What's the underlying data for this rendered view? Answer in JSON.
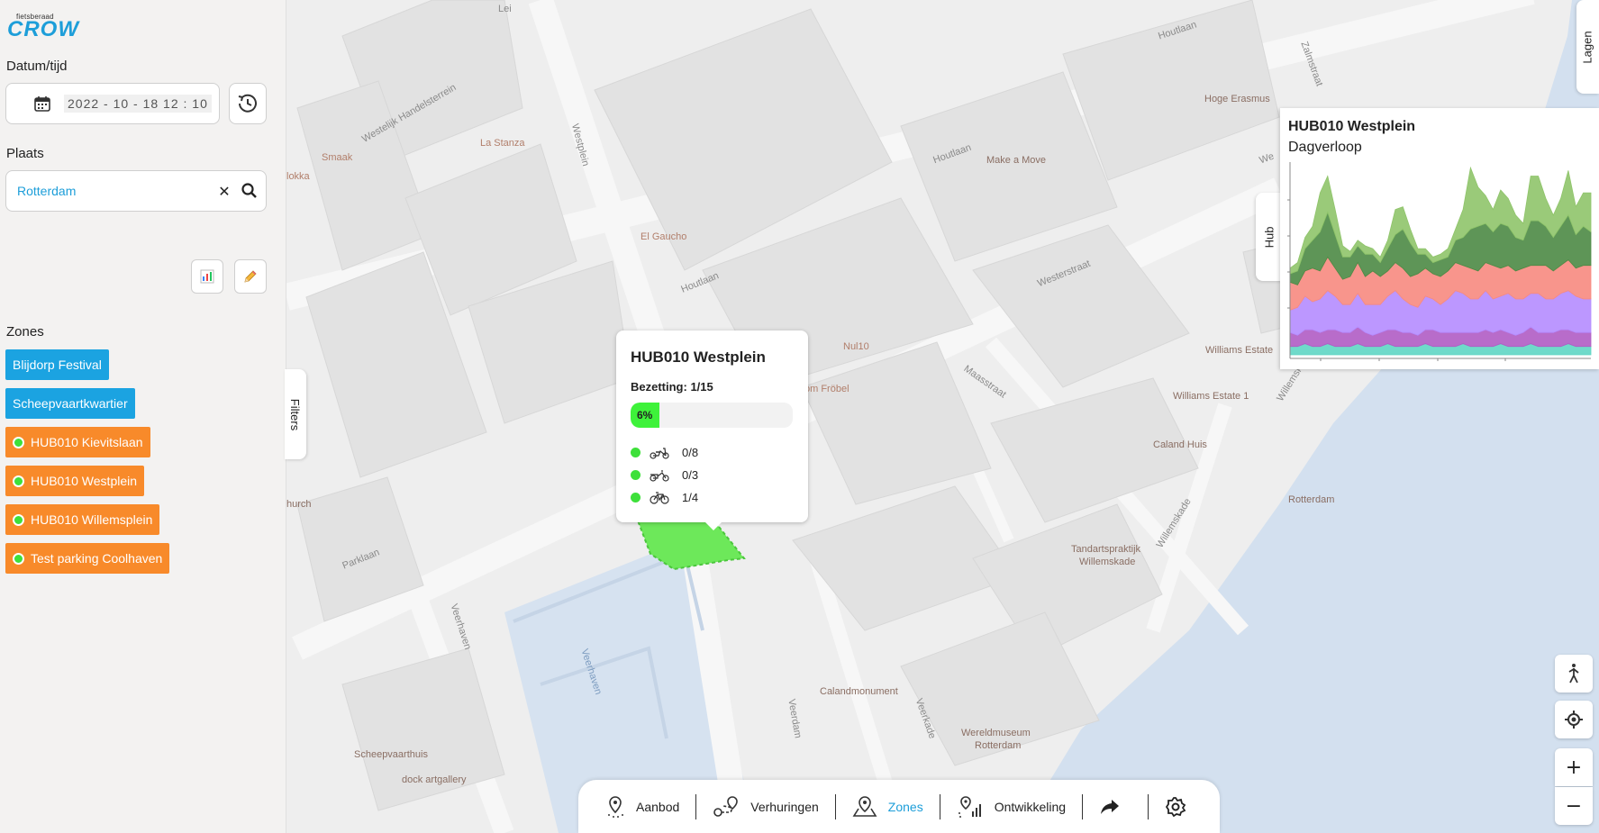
{
  "sidebar": {
    "logo_small": "fietsberaad",
    "logo_big": "CROW",
    "datetime_label": "Datum/tijd",
    "date_value": "2022 - 10 - 18   12 : 10",
    "place_label": "Plaats",
    "place_value": "Rotterdam",
    "zones_label": "Zones",
    "zones": [
      {
        "label": "Blijdorp Festival",
        "type": "blue"
      },
      {
        "label": "Scheepvaartkwartier",
        "type": "blue"
      },
      {
        "label": "HUB010 Kievitslaan",
        "type": "orange"
      },
      {
        "label": "HUB010 Westplein",
        "type": "orange"
      },
      {
        "label": "HUB010 Willemsplein",
        "type": "orange"
      },
      {
        "label": "Test parking Coolhaven",
        "type": "orange"
      }
    ],
    "chart_button_icon": "bar-chart-icon",
    "edit_button_icon": "pencil-icon"
  },
  "tabs": {
    "filters": "Filters",
    "lagen": "Lagen",
    "hub": "Hub"
  },
  "map_labels": {
    "lei": "Lei",
    "houtlaan_1": "Houtlaan",
    "zalmstraat": "Zalmstraat",
    "hoge_erasmus": "Hoge Erasmus",
    "smaak": "Smaak",
    "westelijk": "Westelijk Handelsterrein",
    "la_stanza": "La Stanza",
    "westplein": "Westplein",
    "okka": "lokka",
    "houtlaan_2": "Houtlaan",
    "make_a_move": "Make a Move",
    "el_gaucho": "El Gaucho",
    "houtlaan_3": "Houtlaan",
    "westerstraat": "Westerstraat",
    "nul10": "Nul10",
    "fr": "om Fröbel",
    "maasstraat": "Maasstraat",
    "williams_estate": "Williams Estate",
    "williams_estate_1": "Williams Estate 1",
    "caland_huis": "Caland Huis",
    "church": "hurch",
    "willemskade": "Willemskade",
    "rotterdam": "Rotterdam",
    "parklaan": "Parklaan",
    "tandarts_1": "Tandartspraktijk",
    "tandarts_2": "Willemskade",
    "veerhaven_1": "Veerhaven",
    "veerhaven_2": "Veerhaven",
    "calandmonument": "Calandmonument",
    "veerdam": "Veerdam",
    "veerkade": "Veerkade",
    "wereldmuseum_1": "Wereldmuseum",
    "wereldmuseum_2": "Rotterdam",
    "scheepvaarthuis": "Scheepvaarthuis",
    "dock": "dock artgallery",
    "willemsk2": "Willemsk",
    "wes1": "We",
    "wes2": "We"
  },
  "popup": {
    "title": "HUB010 Westplein",
    "occupancy": "Bezetting: 1/15",
    "percent_text": "6%",
    "percent_value": 0.06,
    "rows": [
      {
        "icon": "scooter-icon",
        "value": "0/8"
      },
      {
        "icon": "cargo-bike-icon",
        "value": "0/3"
      },
      {
        "icon": "bicycle-icon",
        "value": "1/4"
      }
    ]
  },
  "chart_panel": {
    "title": "HUB010 Westplein",
    "subtitle": "Dagverloop"
  },
  "chart_data": {
    "type": "area",
    "stacked": true,
    "x": [
      0,
      1,
      2,
      3,
      4,
      5,
      6,
      7,
      8,
      9,
      10,
      11,
      12,
      13,
      14,
      15,
      16,
      17,
      18,
      19,
      20,
      21,
      22,
      23,
      24,
      25,
      26,
      27,
      28,
      29,
      30,
      31,
      32,
      33,
      34,
      35,
      36,
      37,
      38,
      39,
      40
    ],
    "series": [
      {
        "color": "#5fd6c4",
        "values": [
          3,
          3,
          4,
          3,
          3,
          4,
          3,
          3,
          3,
          4,
          3,
          3,
          3,
          4,
          3,
          3,
          3,
          3,
          4,
          3,
          3,
          3,
          3,
          4,
          3,
          3,
          3,
          3,
          4,
          3,
          3,
          3,
          4,
          3,
          3,
          3,
          3,
          4,
          3,
          3,
          3
        ]
      },
      {
        "color": "#b05cc4",
        "values": [
          5,
          4,
          5,
          6,
          5,
          5,
          6,
          5,
          5,
          6,
          5,
          4,
          5,
          5,
          6,
          5,
          5,
          4,
          5,
          6,
          5,
          5,
          5,
          4,
          5,
          5,
          6,
          5,
          5,
          5,
          4,
          5,
          6,
          5,
          5,
          5,
          6,
          5,
          5,
          5,
          5
        ]
      },
      {
        "color": "#b58cff",
        "values": [
          8,
          10,
          12,
          10,
          12,
          14,
          12,
          10,
          10,
          12,
          10,
          11,
          10,
          12,
          14,
          12,
          10,
          10,
          12,
          11,
          10,
          12,
          15,
          14,
          12,
          12,
          14,
          12,
          12,
          14,
          13,
          12,
          12,
          14,
          12,
          12,
          13,
          14,
          13,
          12,
          12
        ]
      },
      {
        "color": "#f78a80",
        "values": [
          10,
          8,
          9,
          12,
          10,
          12,
          10,
          9,
          10,
          11,
          10,
          12,
          10,
          9,
          10,
          11,
          10,
          12,
          10,
          9,
          10,
          10,
          10,
          10,
          11,
          10,
          10,
          12,
          10,
          10,
          10,
          11,
          10,
          10,
          12,
          10,
          10,
          11,
          10,
          12,
          12
        ]
      },
      {
        "color": "#4d8a45",
        "values": [
          3,
          5,
          8,
          10,
          14,
          16,
          12,
          8,
          7,
          6,
          8,
          6,
          5,
          8,
          10,
          14,
          12,
          7,
          5,
          4,
          6,
          5,
          8,
          10,
          14,
          16,
          14,
          12,
          16,
          14,
          12,
          10,
          16,
          16,
          14,
          12,
          14,
          16,
          12,
          14,
          12
        ]
      },
      {
        "color": "#8fc46a",
        "values": [
          2,
          3,
          4,
          5,
          14,
          13,
          9,
          4,
          2,
          2,
          3,
          2,
          2,
          3,
          9,
          8,
          5,
          2,
          2,
          2,
          2,
          3,
          4,
          10,
          22,
          14,
          10,
          8,
          12,
          10,
          8,
          6,
          16,
          16,
          10,
          8,
          10,
          16,
          10,
          12,
          14
        ]
      }
    ],
    "xlabel": "",
    "ylabel": ""
  },
  "controls": {
    "pedestrian_icon": "pedestrian-icon",
    "locate_icon": "locate-icon",
    "zoom_in": "+",
    "zoom_out": "−"
  },
  "bottomnav": {
    "items": [
      {
        "label": "Aanbod",
        "icon": "pin-icon"
      },
      {
        "label": "Verhuringen",
        "icon": "route-icon"
      },
      {
        "label": "Zones",
        "icon": "zone-pin-icon"
      },
      {
        "label": "Ontwikkeling",
        "icon": "growth-icon"
      }
    ],
    "active_color": "#1d9ed9"
  },
  "colors": {
    "accent_blue": "#1ba3e1",
    "zone_orange": "#f88a2a",
    "status_green": "#3ee03a"
  }
}
